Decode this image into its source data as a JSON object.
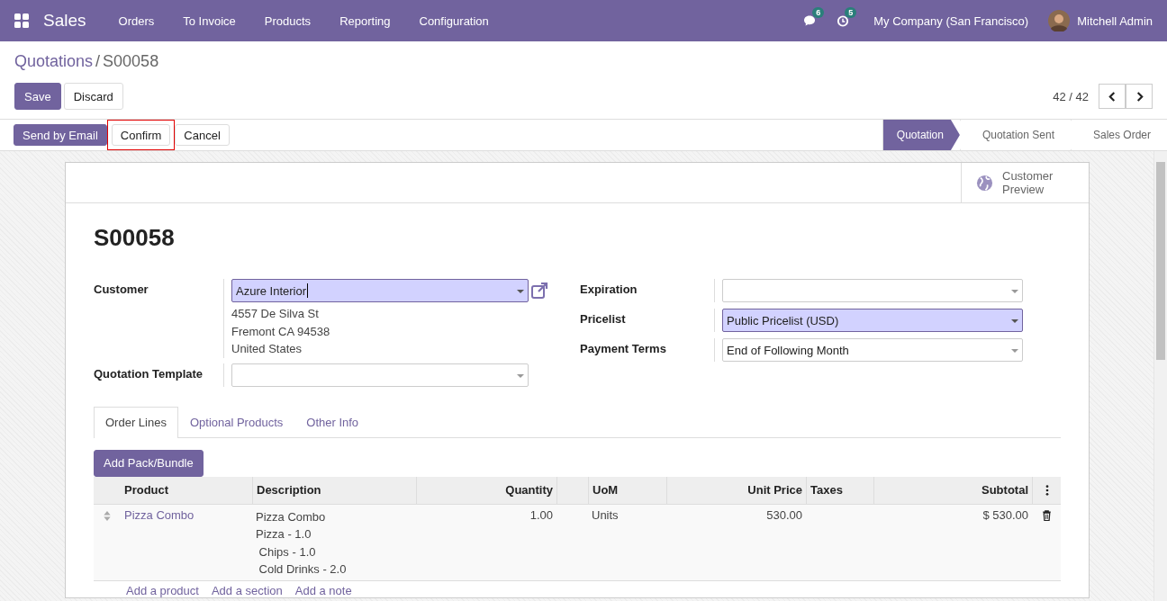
{
  "navbar": {
    "app": "Sales",
    "menu": [
      "Orders",
      "To Invoice",
      "Products",
      "Reporting",
      "Configuration"
    ],
    "messages_count": "6",
    "activities_count": "5",
    "company": "My Company (San Francisco)",
    "user": "Mitchell Admin"
  },
  "breadcrumb": {
    "parent": "Quotations",
    "separator": "/",
    "current": "S00058"
  },
  "actions": {
    "save": "Save",
    "discard": "Discard",
    "pager": "42 / 42"
  },
  "header_buttons": [
    {
      "label": "Send by Email",
      "kind": "primary",
      "highlighted": false
    },
    {
      "label": "Confirm",
      "kind": "secondary",
      "highlighted": true
    },
    {
      "label": "Cancel",
      "kind": "secondary",
      "highlighted": false
    }
  ],
  "statusbar": [
    {
      "label": "Quotation",
      "selected": true
    },
    {
      "label": "Quotation Sent",
      "selected": false
    },
    {
      "label": "Sales Order",
      "selected": false
    }
  ],
  "smart_button": {
    "label": "Customer Preview"
  },
  "title": "S00058",
  "left_fields": [
    {
      "label": "Customer",
      "value": "Azure Interior",
      "required": true,
      "external_link": true,
      "address": [
        "4557 De Silva St",
        "Fremont CA 94538",
        "United States"
      ]
    },
    {
      "label": "Quotation Template",
      "required": false,
      "external_link": false
    }
  ],
  "right_fields": [
    {
      "label": "Expiration",
      "required": false
    },
    {
      "label": "Pricelist",
      "value": "Public Pricelist (USD)",
      "required": true
    },
    {
      "label": "Payment Terms",
      "value": "End of Following Month",
      "required": false
    }
  ],
  "tabs": [
    {
      "label": "Order Lines",
      "selected": true
    },
    {
      "label": "Optional Products",
      "selected": false
    },
    {
      "label": "Other Info",
      "selected": false
    }
  ],
  "add_button": "Add Pack/Bundle",
  "table": {
    "columns": [
      "Product",
      "Description",
      "Quantity",
      "UoM",
      "Unit Price",
      "Taxes",
      "Subtotal"
    ],
    "rows": [
      {
        "product": "Pizza Combo",
        "description": [
          "Pizza Combo",
          "Pizza - 1.0",
          " Chips - 1.0",
          " Cold Drinks - 2.0"
        ],
        "quantity": "1.00",
        "uom": "Units",
        "unit_price": "530.00",
        "subtotal": "$ 530.00"
      }
    ],
    "add_links": [
      "Add a product",
      "Add a section",
      "Add a note"
    ]
  }
}
